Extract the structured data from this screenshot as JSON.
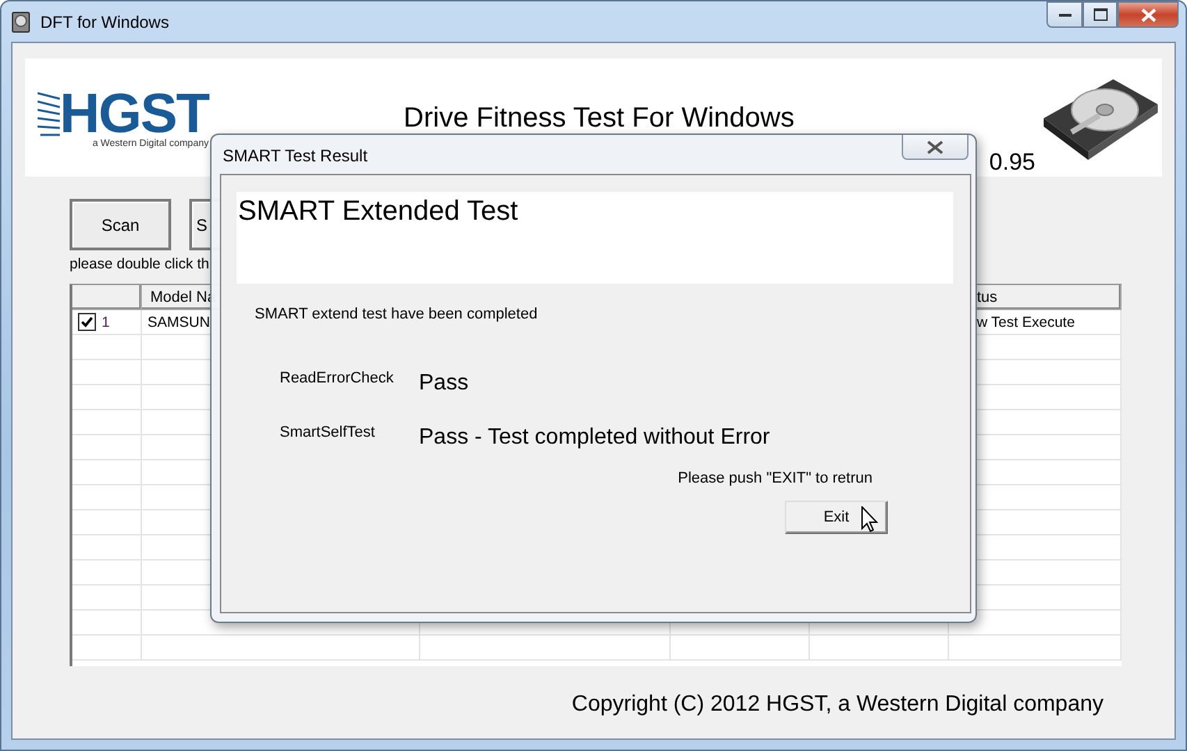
{
  "window": {
    "title": "DFT for Windows"
  },
  "banner": {
    "logo_text": "HGST",
    "logo_subtitle": "a Western Digital company",
    "title": "Drive Fitness Test For Windows",
    "version": "0.95"
  },
  "buttons": [
    {
      "label": "Scan"
    },
    {
      "label": "S"
    }
  ],
  "hint": "please double click th",
  "table": {
    "column_2_header": "Model Na",
    "column_6_header": "tus",
    "rows": [
      {
        "checked": true,
        "number": "1",
        "column_2": "SAMSUN",
        "column_6": "w Test Execute"
      }
    ]
  },
  "copyright": "Copyright (C) 2012 HGST, a Western Digital company",
  "dialog": {
    "title": "SMART Test Result",
    "heading": "SMART Extended Test",
    "message": "SMART extend test have been completed",
    "results": [
      {
        "label": "ReadErrorCheck",
        "value": "Pass"
      },
      {
        "label": "SmartSelfTest",
        "value": "Pass - Test completed without Error"
      }
    ],
    "prompt": "Please push \"EXIT\" to retrun",
    "exit_button": "Exit"
  }
}
